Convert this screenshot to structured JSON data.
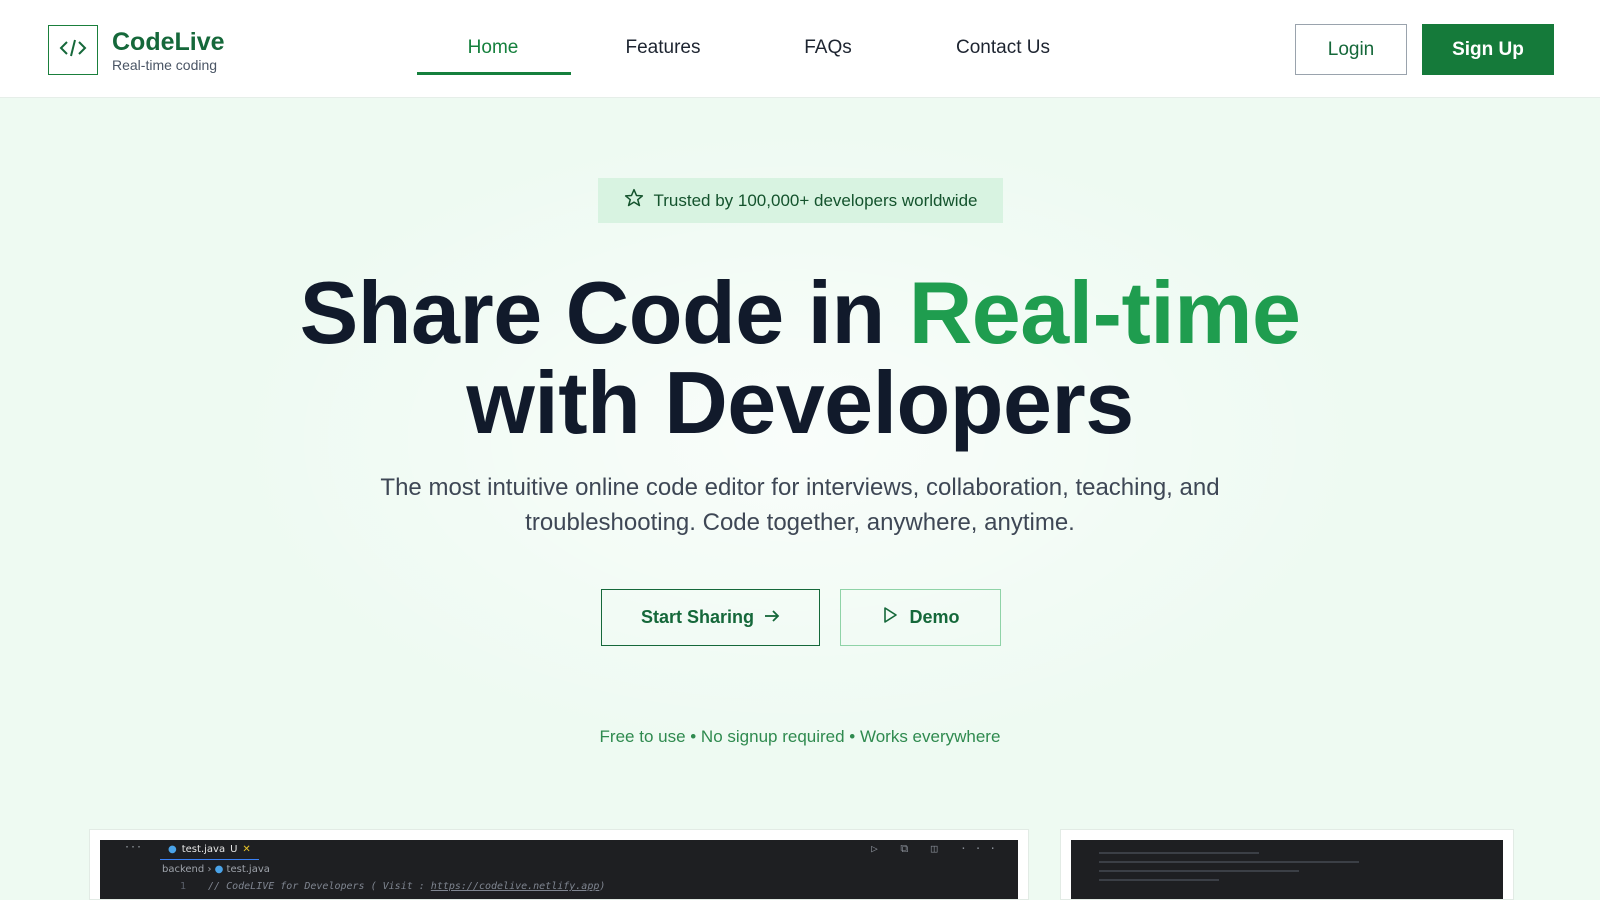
{
  "brand": {
    "name": "CodeLive",
    "tagline": "Real-time coding",
    "logo_icon": "code-brackets-icon"
  },
  "nav": {
    "items": [
      {
        "label": "Home",
        "active": true
      },
      {
        "label": "Features",
        "active": false
      },
      {
        "label": "FAQs",
        "active": false
      },
      {
        "label": "Contact Us",
        "active": false
      }
    ]
  },
  "auth": {
    "login_label": "Login",
    "signup_label": "Sign Up"
  },
  "hero": {
    "badge_icon": "star-icon",
    "badge_text": "Trusted by 100,000+ developers worldwide",
    "title_part1": "Share Code in ",
    "title_accent": "Real-time",
    "title_part2": "with Developers",
    "subtitle": "The most intuitive online code editor for interviews, collaboration, teaching, and troubleshooting. Code together, anywhere, anytime.",
    "primary_cta": "Start Sharing",
    "primary_cta_icon": "arrow-right-icon",
    "secondary_cta": "Demo",
    "secondary_cta_icon": "play-icon",
    "note": "Free to use • No signup required • Works everywhere"
  },
  "preview": {
    "tab_label": "test.java",
    "tab_status": "U",
    "breadcrumb_folder": "backend",
    "breadcrumb_file": "test.java",
    "line_number": "1",
    "code_comment": "// CodeLIVE for Developers ( Visit : ",
    "code_url": "https://codelive.netlify.app",
    "code_comment_end": ")"
  },
  "colors": {
    "brand_green": "#157a3a",
    "accent_green": "#1f9d4f",
    "hero_bg": "#eefaf2",
    "badge_bg": "#d8f3e1"
  }
}
